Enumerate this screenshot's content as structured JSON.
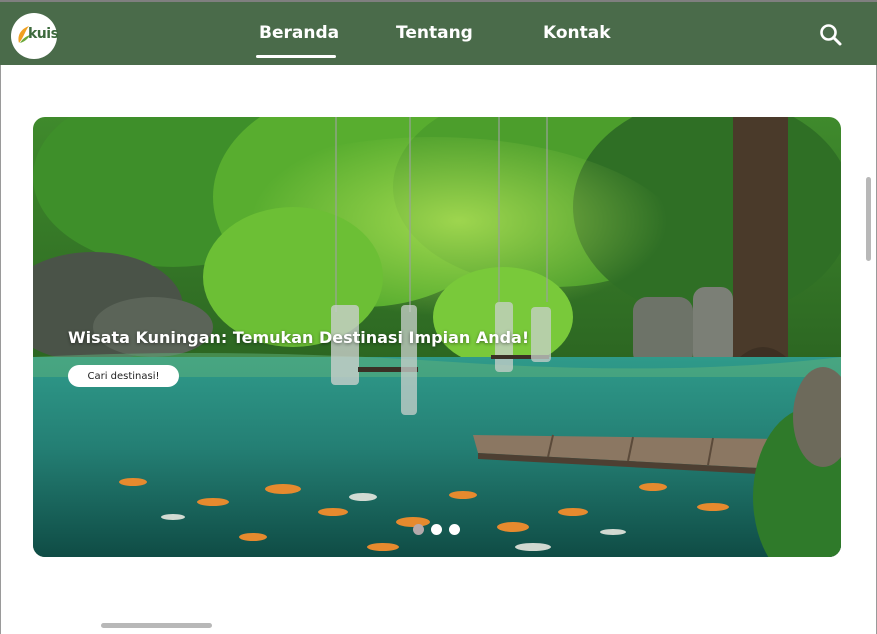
{
  "brand": {
    "logo_text": "kuis",
    "logo_color": "#3d6a3d"
  },
  "nav": {
    "background": "#4a6b4a",
    "items": [
      {
        "label": "Beranda",
        "active": true
      },
      {
        "label": "Tentang",
        "active": false
      },
      {
        "label": "Kontak",
        "active": false
      }
    ],
    "search_icon": "search-icon"
  },
  "hero": {
    "title": "Wisata Kuningan: Temukan Destinasi Impian Anda!",
    "cta_label": "Cari destinasi!",
    "slides_total": 3,
    "active_slide": 1,
    "image": "forest lake with koi fish, rope swings and wooden pier"
  }
}
